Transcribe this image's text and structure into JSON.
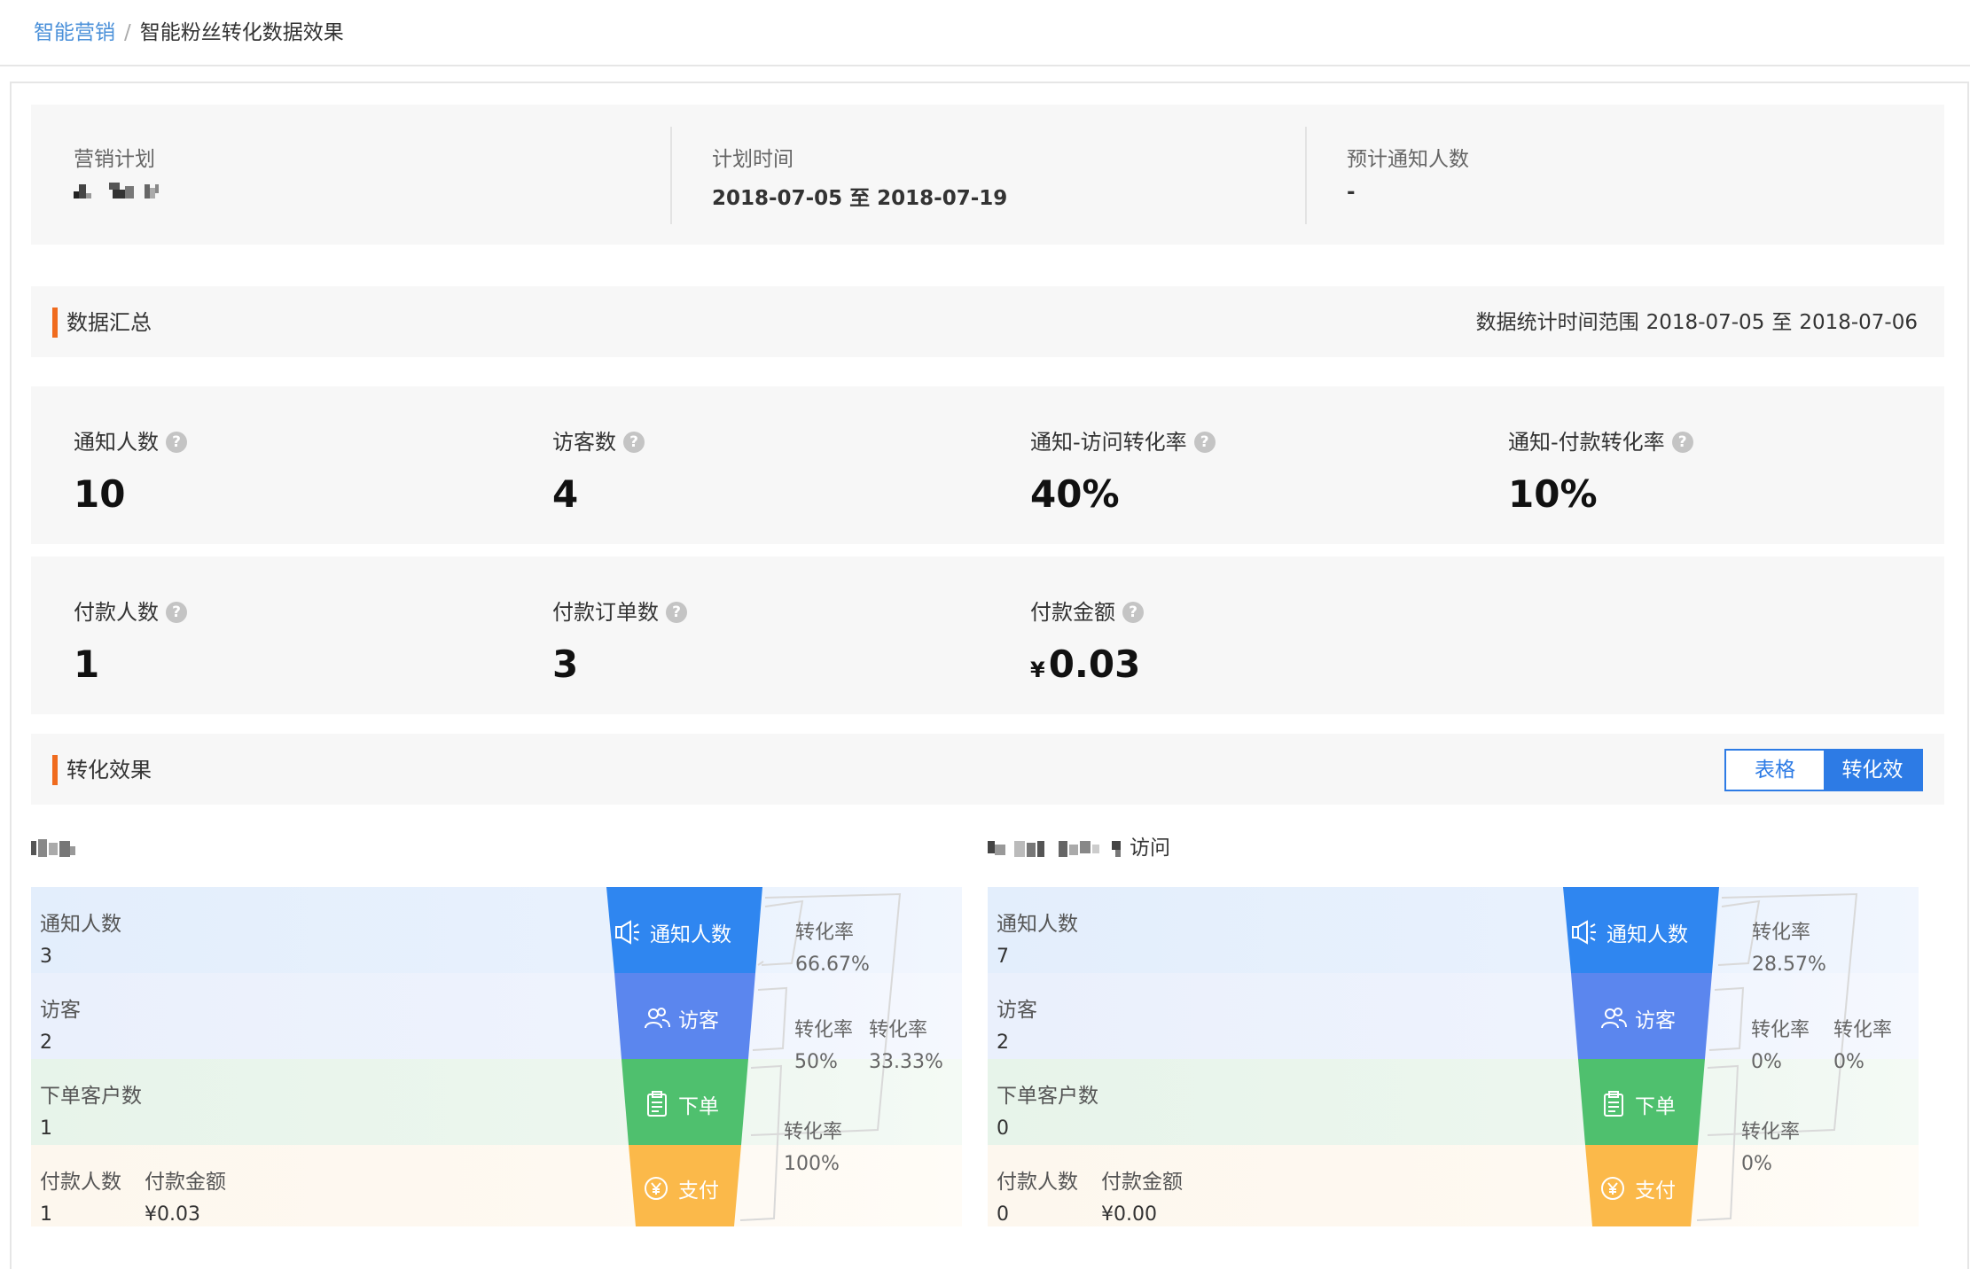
{
  "breadcrumb": {
    "root": "智能营销",
    "separator": "/",
    "current": "智能粉丝转化数据效果"
  },
  "plan": {
    "name_label": "营销计划",
    "name_value": "",
    "time_label": "计划时间",
    "time_value": "2018-07-05 至 2018-07-19",
    "notify_label": "预计通知人数",
    "notify_value": "-"
  },
  "summary": {
    "title": "数据汇总",
    "range_label": "数据统计时间范围",
    "range_start": "2018-07-05",
    "range_to": "至",
    "range_end": "2018-07-06"
  },
  "metrics_row1": [
    {
      "label": "通知人数",
      "value": "10"
    },
    {
      "label": "访客数",
      "value": "4"
    },
    {
      "label": "通知-访问转化率",
      "value": "40%"
    },
    {
      "label": "通知-付款转化率",
      "value": "10%"
    }
  ],
  "metrics_row2": [
    {
      "label": "付款人数",
      "value": "1"
    },
    {
      "label": "付款订单数",
      "value": "3"
    },
    {
      "label": "付款金额",
      "currency": "¥",
      "value": "0.03"
    }
  ],
  "help_glyph": "?",
  "conversion": {
    "title": "转化效果",
    "toggle_table": "表格",
    "toggle_funnel": "转化效"
  },
  "funnel_left": {
    "title_text": "",
    "rows": [
      {
        "key": "通知人数",
        "value": "3"
      },
      {
        "key": "访客",
        "value": "2"
      },
      {
        "key": "下单客户数",
        "value": "1"
      },
      {
        "key": "付款人数",
        "value": "1",
        "key2": "付款金额",
        "value2": "¥0.03"
      }
    ],
    "stages": [
      "通知人数",
      "访客",
      "下单",
      "支付"
    ],
    "rates": [
      {
        "label": "转化率",
        "value": "66.67%"
      },
      {
        "label": "转化率",
        "value": "50%"
      },
      {
        "label": "转化率",
        "value": "33.33%"
      },
      {
        "label": "转化率",
        "value": "100%"
      }
    ]
  },
  "funnel_right": {
    "title_text": "访问",
    "rows": [
      {
        "key": "通知人数",
        "value": "7"
      },
      {
        "key": "访客",
        "value": "2"
      },
      {
        "key": "下单客户数",
        "value": "0"
      },
      {
        "key": "付款人数",
        "value": "0",
        "key2": "付款金额",
        "value2": "¥0.00"
      }
    ],
    "stages": [
      "通知人数",
      "访客",
      "下单",
      "支付"
    ],
    "rates": [
      {
        "label": "转化率",
        "value": "28.57%"
      },
      {
        "label": "转化率",
        "value": "0%"
      },
      {
        "label": "转化率",
        "value": "0%"
      },
      {
        "label": "转化率",
        "value": "0%"
      }
    ]
  },
  "colors": {
    "accent": "#f06b1e",
    "link": "#4a90d9",
    "primary": "#2d7be5",
    "stage_notify": "#2f86f0",
    "stage_visit": "#5b86ee",
    "stage_order": "#4fc06e",
    "stage_pay": "#fbb94a"
  },
  "icons": [
    "speaker-icon",
    "people-icon",
    "clipboard-icon",
    "yen-coin-icon",
    "help-icon"
  ]
}
